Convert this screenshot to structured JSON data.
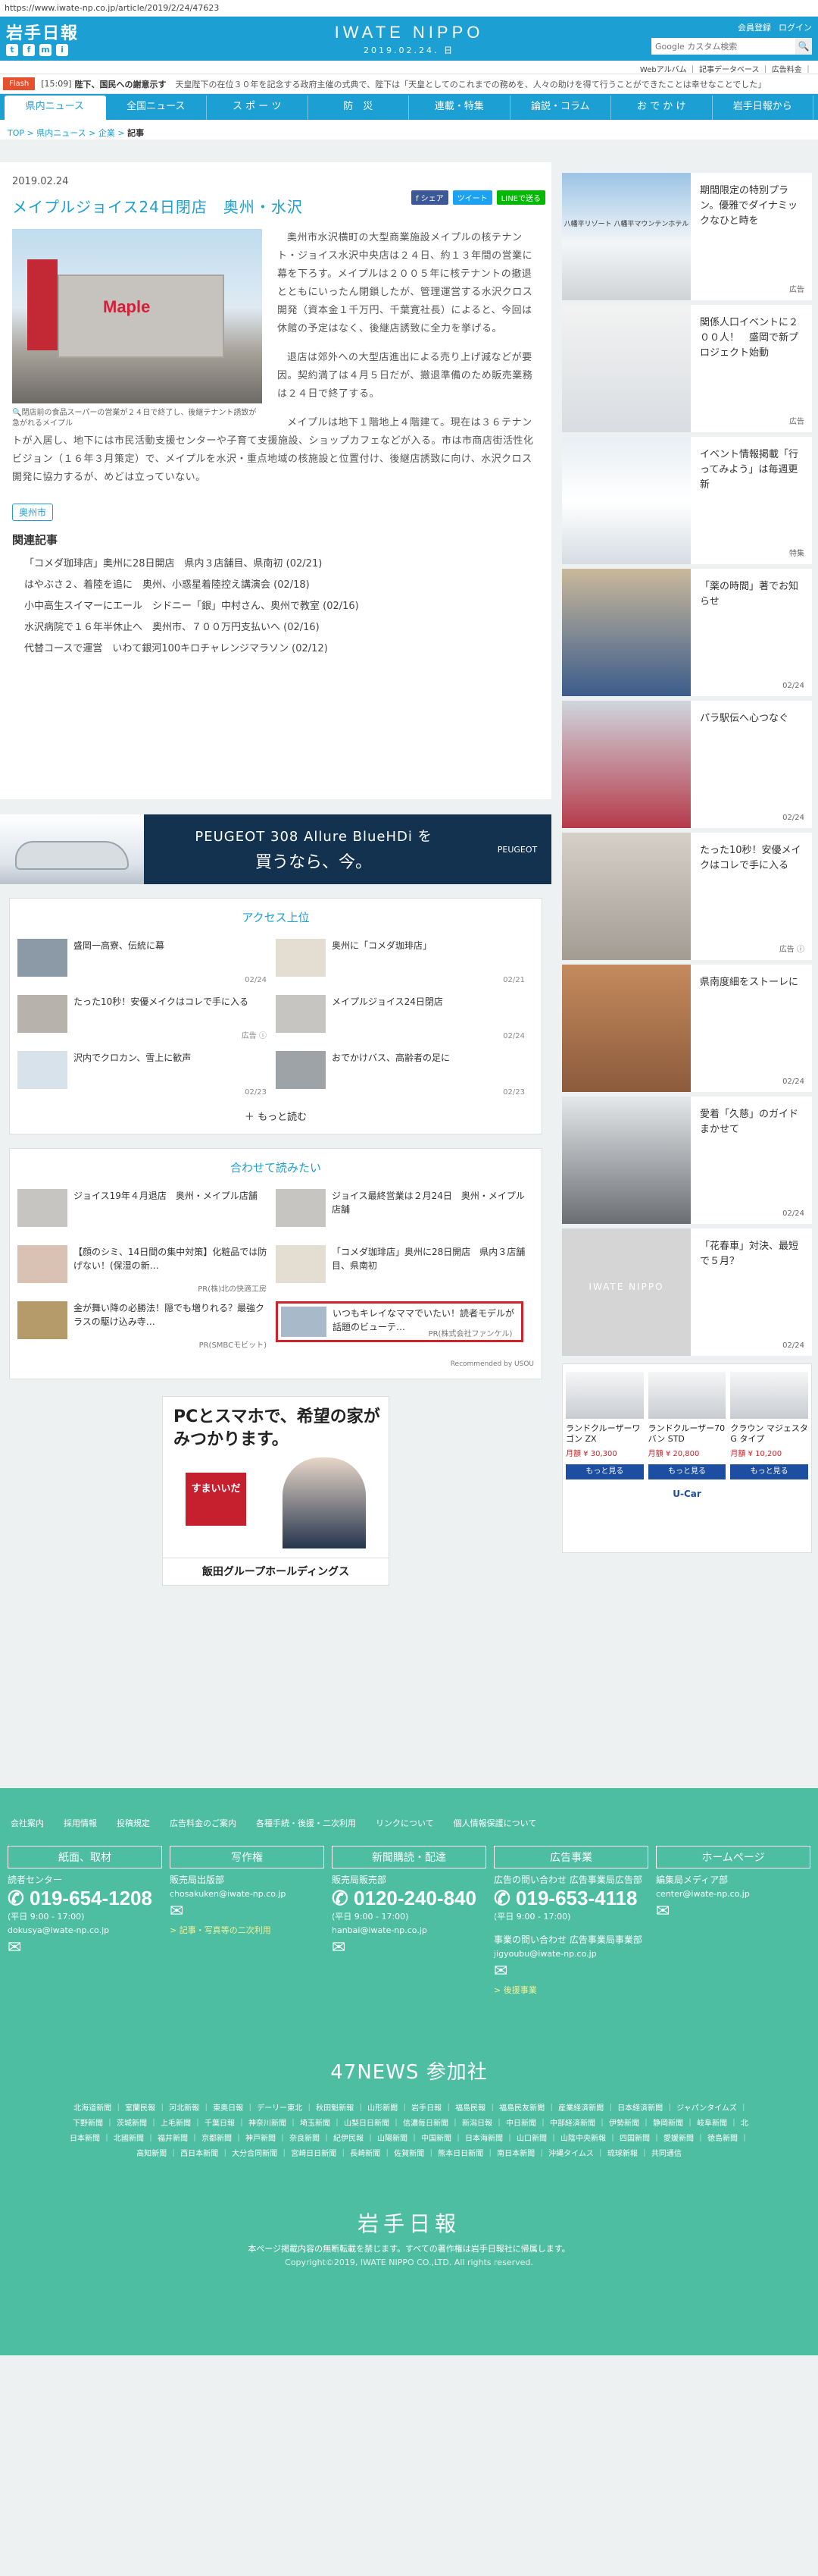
{
  "url": "https://www.iwate-np.co.jp/article/2019/2/24/47623",
  "header": {
    "logo": "岩手日報",
    "brand": "IWATE NIPPO",
    "date": "2019.02.24. 日",
    "links": [
      "会員登録",
      "ログイン"
    ],
    "search_placeholder": "Google カスタム検索",
    "social": [
      "t",
      "f",
      "m",
      "i"
    ]
  },
  "subnav": "Webアルバム ｜ 記事データベース ｜ 広告料金 ｜",
  "flash": {
    "badge": "Flash",
    "time": "[15:09]",
    "title": "陛下、国民への謝意示す",
    "text": "天皇陛下の在位３０年を記念する政府主催の式典で、陛下は「天皇としてのこれまでの務めを、人々の助けを得て行うことができたことは幸せなことでした」"
  },
  "gnav": [
    "県内ニュース",
    "全国ニュース",
    "ス ポ ー ツ",
    "防　災",
    "連載・特集",
    "論説・コラム",
    "お で か け",
    "岩手日報から"
  ],
  "breadcrumb": {
    "a": "TOP",
    "b": "県内ニュース",
    "c": "企業",
    "d": "記事"
  },
  "article": {
    "date": "2019.02.24",
    "share": [
      "f シェア",
      "ツイート",
      "LINEで送る"
    ],
    "title": "メイプルジョイス24日閉店　奥州・水沢",
    "photo_sign": "Maple",
    "caption": "閉店前の食品スーパーの営業が２４日で終了し、後継テナント誘致が急がれるメイプル",
    "p1": "奥州市水沢横町の大型商業施設メイプルの核テナント・ジョイス水沢中央店は２４日、約１３年間の営業に幕を下ろす。メイプルは２００５年に核テナントの撤退とともにいったん閉鎖したが、管理運営する水沢クロス開発（資本金１千万円、千葉寛社長）によると、今回は休館の予定はなく、後継店誘致に全力を挙げる。",
    "p2": "退店は郊外への大型店進出による売り上げ減などが要因。契約満了は４月５日だが、撤退準備のため販売業務は２４日で終了する。",
    "p3": "メイプルは地下１階地上４階建て。現在は３６テナントが入居し、地下には市民活動支援センターや子育て支援施設、ショップカフェなどが入る。市は市商店街活性化ビジョン（１６年３月策定）で、メイプルを水沢・重点地域の核施設と位置付け、後継店誘致に向け、水沢クロス開発に協力するが、めどは立っていない。",
    "tag": "奥州市",
    "related_heading": "関連記事",
    "related": [
      "「コメダ珈琲店」奥州に28日開店　県内３店舗目、県南初 (02/21)",
      "はやぶさ２、着陸を追に　奥州、小惑星着陸控え講演会 (02/18)",
      "小中高生スイマーにエール　シドニー「銀」中村さん、奥州で教室 (02/16)",
      "水沢病院で１６年半休止へ　奥州市、７００万円支払いへ (02/16)",
      "代替コースで運営　いわて銀河100キロチャレンジマラソン (02/12)"
    ]
  },
  "ad_banner": {
    "line1": "PEUGEOT 308 Allure BlueHDi を",
    "line2": "買うなら、今。",
    "logo": "PEUGEOT"
  },
  "access": {
    "heading": "アクセス上位",
    "items": [
      {
        "title": "盛岡一高寮、伝統に幕",
        "date": "02/24"
      },
      {
        "title": "奥州に「コメダ珈琲店」",
        "date": "02/21"
      },
      {
        "title": "たった10秒！安優メイクはコレで手に入る",
        "date": "広告 ⓘ"
      },
      {
        "title": "メイプルジョイス24日閉店",
        "date": "02/24"
      },
      {
        "title": "沢内でクロカン、雪上に歓声",
        "date": "02/23"
      },
      {
        "title": "おでかけバス、高齢者の足に",
        "date": "02/23"
      }
    ],
    "more": "もっと読む"
  },
  "together": {
    "heading": "合わせて読みたい",
    "items": [
      {
        "title": "ジョイス19年４月退店　奥州・メイプル店舗",
        "pr": ""
      },
      {
        "title": "ジョイス最終営業は２月24日　奥州・メイプル店舗",
        "pr": ""
      },
      {
        "title": "【顔のシミ、14日間の集中対策】化粧品では防げない！(保湿の新…",
        "pr": "PR(株)北の快適工房"
      },
      {
        "title": "「コメダ珈琲店」奥州に28日開店　県内３店舗目、県南初",
        "pr": ""
      },
      {
        "title": "金が舞い降の必勝法！隠でも増りれる？最強クラスの駆け込み寺…",
        "pr": "PR(SMBCモビット)"
      },
      {
        "title": "いつもキレイなママでいたい！読者モデルが話題のビューテ…",
        "pr": "PR(株式会社ファンケル)"
      }
    ],
    "recommended": "Recommended by USOU"
  },
  "adbox": {
    "big": "PCとスマホで、希望の家がみつかります。",
    "red": "すまいいだ",
    "company": "飯田グループホールディングス"
  },
  "side": [
    {
      "text": "期間限定の特別プラン。優雅でダイナミックなひと時を",
      "meta": "広告"
    },
    {
      "text": "関係人口イベントに２００人！　盛岡で新プロジェクト始動",
      "meta": "広告"
    },
    {
      "text": "イベント情報掲載「行ってみよう」は毎週更新",
      "meta": "特集"
    },
    {
      "text": "「薬の時間」著でお知らせ",
      "meta": "02/24"
    },
    {
      "text": "パラ駅伝へ心つなぐ",
      "meta": "02/24"
    },
    {
      "text": "たった10秒！安優メイクはコレで手に入る",
      "meta": "広告 ⓘ"
    },
    {
      "text": "県南度細をストーレに",
      "meta": "02/24"
    },
    {
      "text": "愛着「久慈」のガイドまかせて",
      "meta": "02/24"
    },
    {
      "text": "「花春車」対決、最短で５月？",
      "meta": "02/24"
    }
  ],
  "side_ad_top_label": "八幡平リゾート 八幡平マウンテンホテル",
  "carad": {
    "cars": [
      {
        "name": "ランドクルーザーワゴン ZX",
        "price": "月額 ¥ 30,300",
        "btn": "もっと見る"
      },
      {
        "name": "ランドクルーザー70バン STD",
        "price": "月額 ¥ 20,800",
        "btn": "もっと見る"
      },
      {
        "name": "クラウン マジェスタ G タイプ",
        "price": "月額 ¥ 10,200",
        "btn": "もっと見る"
      }
    ],
    "logo": "U-Car"
  },
  "footer": {
    "links": [
      "会社案内",
      "採用情報",
      "投稿規定",
      "広告料金のご案内",
      "各種手続・後援・二次利用",
      "リンクについて",
      "個人情報保護について"
    ],
    "cols": [
      {
        "head": "紙面、取材",
        "label": "読者センター",
        "tel": "019-654-1208",
        "hours": "(平日 9:00 - 17:00)",
        "mail": "dokusya@iwate-np.co.jp",
        "link": ""
      },
      {
        "head": "写作権",
        "label": "販売局出版部",
        "tel": "",
        "hours": "",
        "mail": "chosakuken@iwate-np.co.jp",
        "link": "> 記事・写真等の二次利用"
      },
      {
        "head": "新聞購読・配達",
        "label": "販売局販売部",
        "tel": "0120-240-840",
        "hours": "(平日 9:00 - 17:00)",
        "mail": "hanbai@iwate-np.co.jp",
        "link": ""
      },
      {
        "head": "広告事業",
        "label": "広告の問い合わせ 広告事業局広告部",
        "tel": "019-653-4118",
        "hours": "(平日 9:00 - 17:00)",
        "mail": "jigyoubu@iwate-np.co.jp",
        "link": "> 後援事業"
      },
      {
        "head": "ホームページ",
        "label": "編集局メディア部",
        "tel": "",
        "hours": "",
        "mail": "center@iwate-np.co.jp",
        "link": ""
      }
    ],
    "col4_extra": "事業の問い合わせ 広告事業局事業部",
    "news_title": "47NEWS 参加社",
    "news": [
      "北海道新聞",
      "室蘭民報",
      "河北新報",
      "東奥日報",
      "デーリー東北",
      "秋田魁新報",
      "山形新聞",
      "岩手日報",
      "福島民報",
      "福島民友新聞",
      "産業経済新聞",
      "日本経済新聞",
      "ジャパンタイムズ",
      "下野新聞",
      "茨城新聞",
      "上毛新聞",
      "千葉日報",
      "神奈川新聞",
      "埼玉新聞",
      "山梨日日新聞",
      "信濃毎日新聞",
      "新潟日報",
      "中日新聞",
      "中部経済新聞",
      "伊勢新聞",
      "静岡新聞",
      "岐阜新聞",
      "北日本新聞",
      "北國新聞",
      "福井新聞",
      "京都新聞",
      "神戸新聞",
      "奈良新聞",
      "紀伊民報",
      "山陽新聞",
      "中国新聞",
      "日本海新聞",
      "山口新聞",
      "山陰中央新報",
      "四国新聞",
      "愛媛新聞",
      "徳島新聞",
      "高知新聞",
      "西日本新聞",
      "大分合同新聞",
      "宮崎日日新聞",
      "長崎新聞",
      "佐賀新聞",
      "熊本日日新聞",
      "南日本新聞",
      "沖縄タイムス",
      "琉球新報",
      "共同通信"
    ],
    "logo": "岩手日報",
    "copy1": "本ページ掲載内容の無断転載を禁じます。すべての著作権は岩手日報社に帰属します。",
    "copy2": "Copyright©2019, IWATE NIPPO CO.,LTD. All rights reserved."
  },
  "colors": {
    "brand": "#1c9fd3",
    "footer": "#4dbea1",
    "flash": "#e5502e"
  }
}
